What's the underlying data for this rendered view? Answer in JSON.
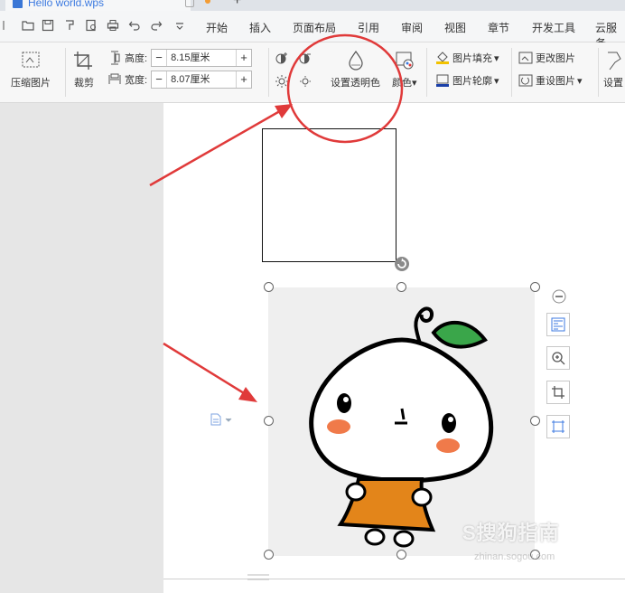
{
  "tab": {
    "title": "Hello world.wps",
    "new_tab": "+"
  },
  "menu": {
    "items": [
      "开始",
      "插入",
      "页面布局",
      "引用",
      "审阅",
      "视图",
      "章节",
      "开发工具",
      "云服务"
    ]
  },
  "ribbon": {
    "compress_label": "压缩图片",
    "crop_label": "裁剪",
    "height_label": "高度:",
    "height_value": "8.15厘米",
    "width_label": "宽度:",
    "width_value": "8.07厘米",
    "minus": "−",
    "plus": "+",
    "transparent_label": "设置透明色",
    "color_label": "颜色",
    "fill_label": "图片填充",
    "outline_label": "图片轮廓",
    "change_label": "更改图片",
    "reset_label": "重设图片",
    "settings_label": "设置",
    "dropdown_arrow": "▾"
  },
  "watermark": {
    "logo": "S搜狗指南",
    "url": "zhinan.sogou.com"
  },
  "colors": {
    "annotation_red": "#e03a3a",
    "accent_blue": "#3c7ae0",
    "leaf_green": "#3aa64a",
    "dress_orange": "#e3851a",
    "cheek": "#f07a4a"
  }
}
